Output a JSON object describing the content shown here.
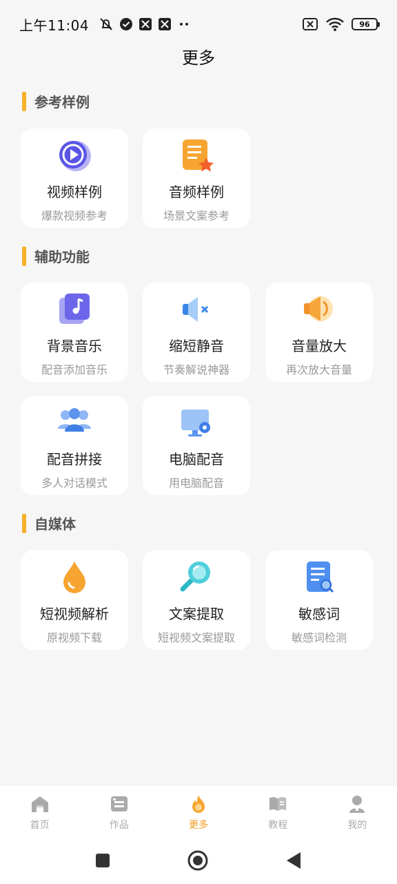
{
  "status_bar": {
    "time": "上午11:04",
    "battery": "96"
  },
  "header": {
    "title": "更多"
  },
  "sections": [
    {
      "title": "参考样例",
      "cards": [
        {
          "title": "视频样例",
          "subtitle": "爆款视频参考",
          "icon": "play-icon"
        },
        {
          "title": "音频样例",
          "subtitle": "场景文案参考",
          "icon": "audio-doc-icon"
        }
      ]
    },
    {
      "title": "辅助功能",
      "cards": [
        {
          "title": "背景音乐",
          "subtitle": "配音添加音乐",
          "icon": "music-note-icon"
        },
        {
          "title": "缩短静音",
          "subtitle": "节奏解说神器",
          "icon": "mute-speaker-icon"
        },
        {
          "title": "音量放大",
          "subtitle": "再次放大音量",
          "icon": "volume-up-icon"
        },
        {
          "title": "配音拼接",
          "subtitle": "多人对话模式",
          "icon": "group-icon"
        },
        {
          "title": "电脑配音",
          "subtitle": "用电脑配音",
          "icon": "monitor-icon"
        }
      ]
    },
    {
      "title": "自媒体",
      "cards": [
        {
          "title": "短视频解析",
          "subtitle": "原视频下载",
          "icon": "drop-icon"
        },
        {
          "title": "文案提取",
          "subtitle": "短视频文案提取",
          "icon": "magnifier-icon"
        },
        {
          "title": "敏感词",
          "subtitle": "敏感词检测",
          "icon": "doc-search-icon"
        }
      ]
    }
  ],
  "bottom_nav": [
    {
      "label": "首页",
      "icon": "home-icon",
      "active": false
    },
    {
      "label": "作品",
      "icon": "works-icon",
      "active": false
    },
    {
      "label": "更多",
      "icon": "fire-icon",
      "active": true
    },
    {
      "label": "教程",
      "icon": "book-icon",
      "active": false
    },
    {
      "label": "我的",
      "icon": "user-icon",
      "active": false
    }
  ],
  "colors": {
    "accent": "#f39a1e",
    "section_bar": "#f6b12a",
    "background": "#f6f6f6"
  }
}
